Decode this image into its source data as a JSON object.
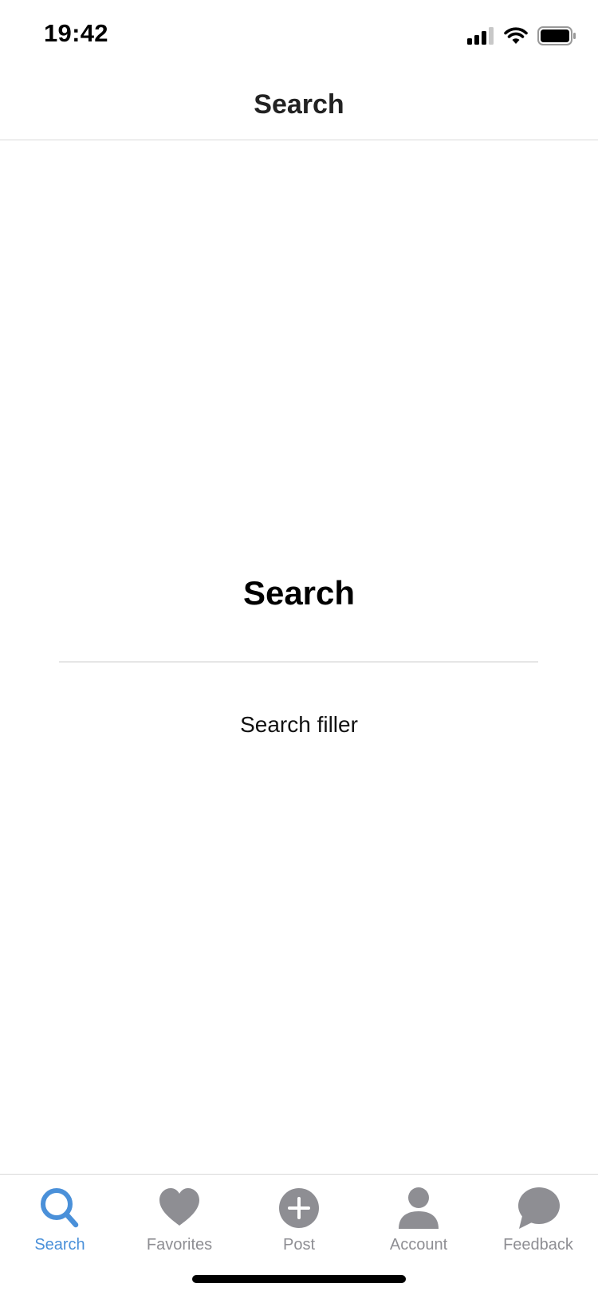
{
  "status_bar": {
    "time": "19:42",
    "icons": [
      "signal-icon",
      "wifi-icon",
      "battery-icon"
    ]
  },
  "header": {
    "title": "Search"
  },
  "main": {
    "title": "Search",
    "filler": "Search filler"
  },
  "tab_bar": {
    "active_color": "#4a90d9",
    "inactive_color": "#8e8e93",
    "tabs": [
      {
        "label": "Search",
        "icon": "search-icon",
        "active": true
      },
      {
        "label": "Favorites",
        "icon": "heart-icon",
        "active": false
      },
      {
        "label": "Post",
        "icon": "plus-circle-icon",
        "active": false
      },
      {
        "label": "Account",
        "icon": "person-icon",
        "active": false
      },
      {
        "label": "Feedback",
        "icon": "chat-bubble-icon",
        "active": false
      }
    ]
  }
}
